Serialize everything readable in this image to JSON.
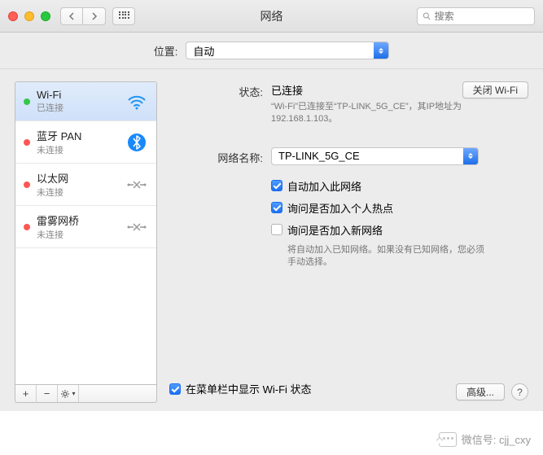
{
  "window": {
    "title": "网络"
  },
  "search": {
    "placeholder": "搜索"
  },
  "location": {
    "label": "位置:",
    "value": "自动"
  },
  "sidebar": {
    "items": [
      {
        "name": "Wi-Fi",
        "status": "已连接"
      },
      {
        "name": "蓝牙 PAN",
        "status": "未连接"
      },
      {
        "name": "以太网",
        "status": "未连接"
      },
      {
        "name": "雷雾网桥",
        "status": "未连接"
      }
    ]
  },
  "details": {
    "status_label": "状态:",
    "status_value": "已连接",
    "wifi_off_btn": "关闭 Wi-Fi",
    "status_desc": "“Wi-Fi”已连接至“TP-LINK_5G_CE”，其IP地址为192.168.1.103。",
    "network_name_label": "网络名称:",
    "network_name_value": "TP-LINK_5G_CE",
    "auto_join": "自动加入此网络",
    "ask_hotspot": "询问是否加入个人热点",
    "ask_new": "询问是否加入新网络",
    "ask_new_hint": "将自动加入已知网络。如果没有已知网络，您必须手动选择。",
    "menubar": "在菜单栏中显示 Wi-Fi 状态",
    "advanced_btn": "高级...",
    "help": "?"
  },
  "watermark": {
    "text": "微信号: cjj_cxy"
  }
}
